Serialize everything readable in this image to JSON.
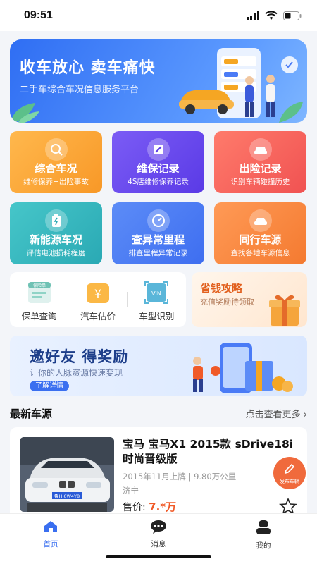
{
  "status": {
    "time": "09:51"
  },
  "banner": {
    "title": "收车放心 卖车痛快",
    "subtitle": "二手车综合车况信息服务平台"
  },
  "services": [
    {
      "title": "综合车况",
      "sub": "维修保养+出险事故",
      "icon": "car-search-icon"
    },
    {
      "title": "维保记录",
      "sub": "4S店维修保养记录",
      "icon": "wrench-icon"
    },
    {
      "title": "出险记录",
      "sub": "识别车辆碰撞历史",
      "icon": "car-crash-icon"
    },
    {
      "title": "新能源车况",
      "sub": "评估电池损耗程度",
      "icon": "battery-icon"
    },
    {
      "title": "查异常里程",
      "sub": "排查里程异常记录",
      "icon": "odometer-icon"
    },
    {
      "title": "同行车源",
      "sub": "查找各地车源信息",
      "icon": "car-icon"
    }
  ],
  "tools": [
    {
      "label": "保单查询",
      "icon": "policy-icon",
      "badge": "保险单"
    },
    {
      "label": "汽车估价",
      "icon": "yen-icon",
      "badge": "¥"
    },
    {
      "label": "车型识别",
      "icon": "vin-scan-icon",
      "badge": "VIN"
    }
  ],
  "promo": {
    "title": "省钱攻略",
    "sub": "充值奖励待领取"
  },
  "invite": {
    "title": "邀好友  得奖励",
    "sub": "让你的人脉资源快速变现",
    "button": "了解详情"
  },
  "section": {
    "title": "最新车源",
    "more": "点击查看更多"
  },
  "listing": {
    "title": "宝马 宝马X1 2015款 sDrive18i 时尚晋级版",
    "meta": "2015年11月上牌  |  9.80万公里",
    "location": "济宁",
    "price_label": "售价:",
    "price": "7.*万",
    "plate": "鲁H·6W4Y8"
  },
  "fab": {
    "label": "发布车辆"
  },
  "tabs": [
    {
      "label": "首页",
      "active": true
    },
    {
      "label": "消息",
      "active": false
    },
    {
      "label": "我的",
      "active": false
    }
  ],
  "colors": {
    "accent": "#3a6ff0",
    "price": "#f05a28"
  }
}
